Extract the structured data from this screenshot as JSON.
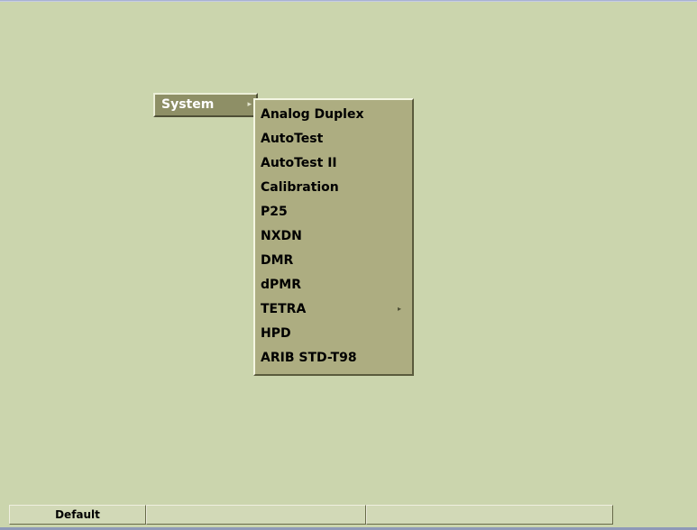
{
  "system_menu": {
    "label": "System",
    "arrow": "▸"
  },
  "dropdown": {
    "items": [
      {
        "label": "Analog Duplex"
      },
      {
        "label": "AutoTest"
      },
      {
        "label": "AutoTest II"
      },
      {
        "label": "Calibration"
      },
      {
        "label": "P25"
      },
      {
        "label": "NXDN"
      },
      {
        "label": "DMR"
      },
      {
        "label": "dPMR"
      },
      {
        "label": "TETRA",
        "submenu_arrow": "▸"
      },
      {
        "label": "HPD"
      },
      {
        "label": "ARIB STD-T98"
      }
    ]
  },
  "status_bar": {
    "cells": [
      "Default",
      "",
      ""
    ]
  },
  "colors": {
    "screen_bg": "#cbd5ad",
    "menu_bg": "#adad81",
    "button_bg": "#8e8f66"
  }
}
